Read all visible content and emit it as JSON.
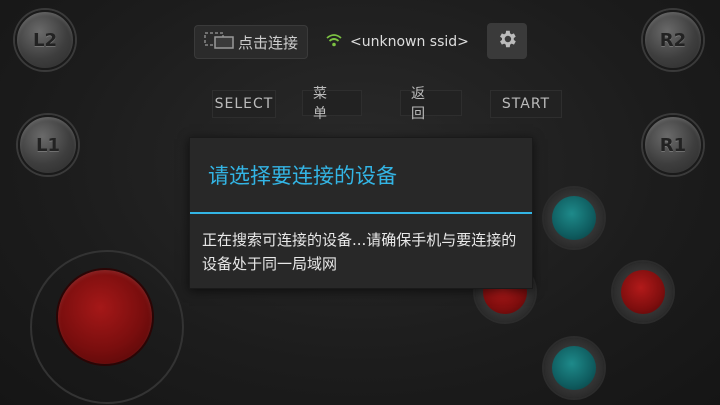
{
  "shoulder_buttons": {
    "l2": "L2",
    "r2": "R2",
    "l1": "L1",
    "r1": "R1"
  },
  "toolbar": {
    "connect_label": "点击连接",
    "ssid": "<unknown ssid>",
    "wifi_icon": "wifi-icon",
    "settings_icon": "gear-icon"
  },
  "menu": {
    "select": "SELECT",
    "menu": "菜单",
    "back": "返回",
    "start": "START"
  },
  "dialog": {
    "title": "请选择要连接的设备",
    "message": "正在搜索可连接的设备...请确保手机与要连接的设备处于同一局域网"
  },
  "colors": {
    "accent": "#33b5e5",
    "wifi": "#7cc242",
    "teal": "#0f5d60",
    "red": "#7f0e0e"
  }
}
